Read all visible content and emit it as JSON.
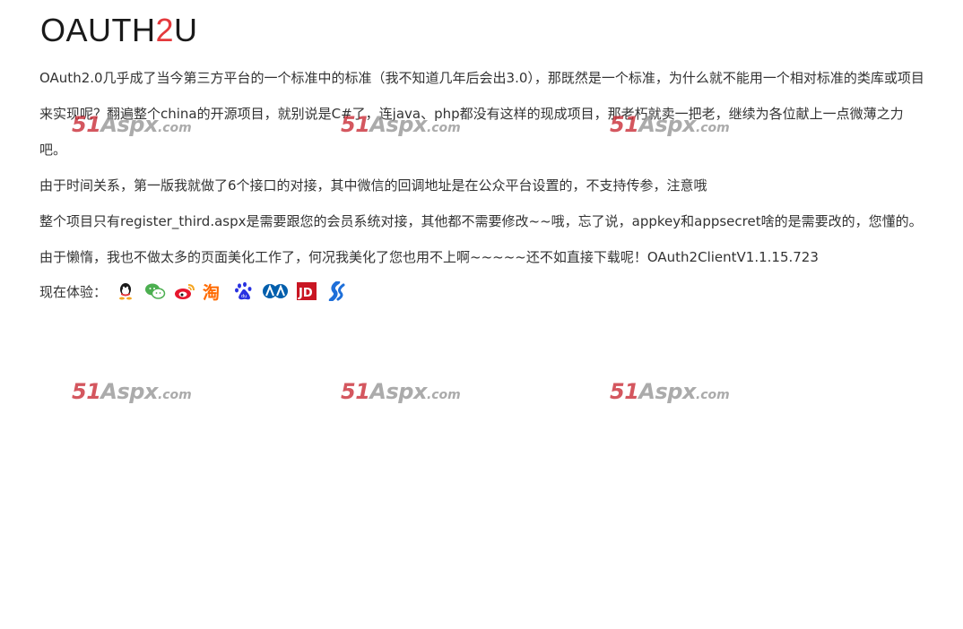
{
  "logo": {
    "part1": "OAUTH",
    "part2": "2",
    "part3": "U"
  },
  "paragraphs": [
    "OAuth2.0几乎成了当今第三方平台的一个标准中的标准（我不知道几年后会出3.0），那既然是一个标准，为什么就不能用一个相对标准的类库或项目来实现呢？翻遍整个china的开源项目，就别说是C#了，连java、php都没有这样的现成项目，那老朽就卖一把老，继续为各位献上一点微薄之力吧。",
    "由于时间关系，第一版我就做了6个接口的对接，其中微信的回调地址是在公众平台设置的，不支持传参，注意哦",
    "整个项目只有register_third.aspx是需要跟您的会员系统对接，其他都不需要修改~~哦，忘了说，appkey和appsecret啥的是需要改的，您懂的。",
    "由于懒惰，我也不做太多的页面美化工作了，何况我美化了您也用不上啊~~~~~还不如直接下载呢！OAuth2ClientV1.1.15.723"
  ],
  "try_label": "现在体验：",
  "providers": [
    {
      "name": "qq-icon",
      "color": "#1a1a1a"
    },
    {
      "name": "wechat-icon",
      "color": "#4caf50"
    },
    {
      "name": "weibo-icon",
      "color": "#e6162d"
    },
    {
      "name": "taobao-icon",
      "color": "#ff6a00"
    },
    {
      "name": "baidu-icon",
      "color": "#2932e1"
    },
    {
      "name": "renren-icon",
      "color": "#005eac"
    },
    {
      "name": "jd-icon",
      "color": "#c91623"
    },
    {
      "name": "kaixin-icon",
      "color": "#1e6fd9"
    }
  ],
  "watermark": {
    "brand": "51",
    "mid": "Aspx",
    "suffix": ".com"
  }
}
